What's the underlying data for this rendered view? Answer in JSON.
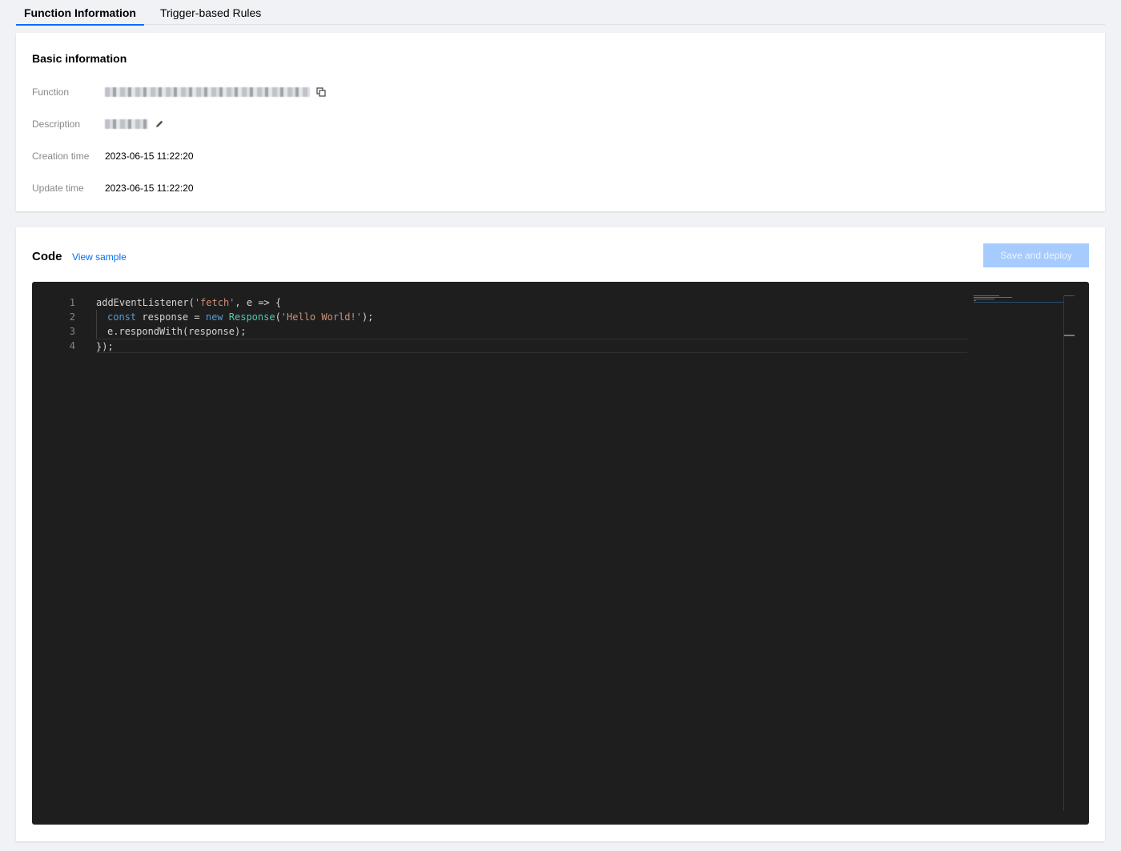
{
  "tabs": [
    {
      "label": "Function Information",
      "active": true
    },
    {
      "label": "Trigger-based Rules",
      "active": false
    }
  ],
  "basic_info": {
    "title": "Basic information",
    "rows": [
      {
        "label": "Function",
        "value": ""
      },
      {
        "label": "Description",
        "value": ""
      },
      {
        "label": "Creation time",
        "value": "2023-06-15 11:22:20"
      },
      {
        "label": "Update time",
        "value": "2023-06-15 11:22:20"
      }
    ],
    "icons": {
      "copy": "copy-icon",
      "edit": "pencil-icon"
    }
  },
  "code_section": {
    "title": "Code",
    "view_sample_label": "View sample",
    "deploy_label": "Save and deploy",
    "deploy_enabled": false
  },
  "editor": {
    "line_numbers": [
      "1",
      "2",
      "3",
      "4"
    ],
    "lines": [
      "addEventListener('fetch', e => {",
      "  const response = new Response('Hello World!');",
      "  e.respondWith(response);",
      "});"
    ],
    "colors": {
      "background": "#1e1e1e",
      "string": "#ce9178",
      "keyword": "#569cd6",
      "type": "#4ec9b0",
      "text": "#d4d4d4"
    }
  },
  "colors": {
    "accent": "#006eff",
    "button_disabled": "#a6cbff",
    "page_background": "#f1f2f5"
  }
}
